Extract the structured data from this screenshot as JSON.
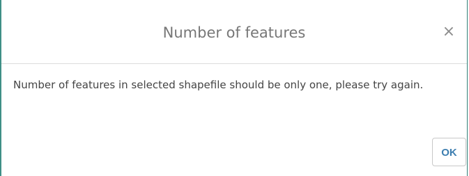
{
  "dialog": {
    "title": "Number of features",
    "close_icon": "×",
    "message": "Number of features in selected shapefile should be only one, please try again.",
    "ok_label": "OK"
  },
  "colors": {
    "accent_border": "#3f8f86",
    "ok_text": "#3d7eb0",
    "title_text": "#777777"
  }
}
